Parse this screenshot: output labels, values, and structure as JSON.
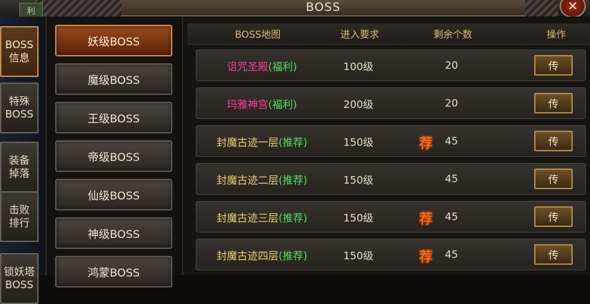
{
  "window": {
    "title": "BOSS",
    "top_left_label": "利"
  },
  "left_tabs": [
    {
      "label": "BOSS\n信息",
      "active": true
    },
    {
      "label": "特殊\nBOSS",
      "active": false
    },
    {
      "label": "装备\n掉落",
      "active": false
    },
    {
      "label": "击败\n排行",
      "active": false
    },
    {
      "label": "锁妖塔\nBOSS",
      "active": false
    }
  ],
  "categories": [
    {
      "label": "妖级BOSS",
      "active": true
    },
    {
      "label": "魔级BOSS",
      "active": false
    },
    {
      "label": "王级BOSS",
      "active": false
    },
    {
      "label": "帝级BOSS",
      "active": false
    },
    {
      "label": "仙级BOSS",
      "active": false
    },
    {
      "label": "神级BOSS",
      "active": false
    },
    {
      "label": "鸿蒙BOSS",
      "active": false
    }
  ],
  "table": {
    "headers": [
      "BOSS地图",
      "进入要求",
      "剩余个数",
      "操作"
    ],
    "rows": [
      {
        "map": "诅咒圣殿",
        "tag": "(福利)",
        "map_color": "pink",
        "req": "100级",
        "count": "20",
        "recommended": false,
        "action": "传"
      },
      {
        "map": "玛雅神宫",
        "tag": "(福利)",
        "map_color": "pink",
        "req": "200级",
        "count": "20",
        "recommended": false,
        "action": "传"
      },
      {
        "map": "封魔古迹一层",
        "tag": "(推荐)",
        "map_color": "gold",
        "req": "150级",
        "count": "45",
        "recommended": true,
        "action": "传"
      },
      {
        "map": "封魔古迹二层",
        "tag": "(推荐)",
        "map_color": "gold",
        "req": "150级",
        "count": "45",
        "recommended": false,
        "action": "传"
      },
      {
        "map": "封魔古迹三层",
        "tag": "(推荐)",
        "map_color": "gold",
        "req": "150级",
        "count": "45",
        "recommended": true,
        "action": "传"
      },
      {
        "map": "封魔古迹四层",
        "tag": "(推荐)",
        "map_color": "gold",
        "req": "150级",
        "count": "45",
        "recommended": true,
        "action": "传"
      }
    ],
    "recommend_glyph": "荐"
  },
  "icons": {
    "close": "close-icon",
    "recommend": "recommend-badge-icon"
  },
  "colors": {
    "accent": "#d9b878",
    "pink": "#ff3a9a",
    "green": "#52e05a",
    "gold": "#e8d070"
  }
}
